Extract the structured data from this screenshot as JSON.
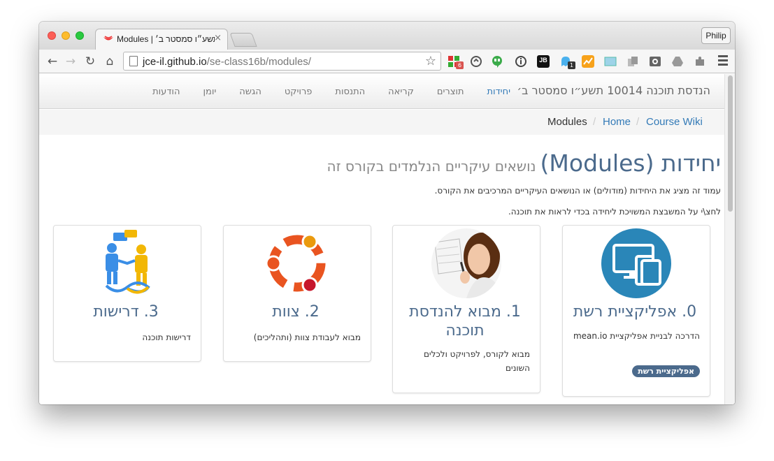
{
  "browser": {
    "tab_title": "Modules | תשע״ו סמסטר ב׳",
    "tab_close": "×",
    "profile": "Philip",
    "url_domain": "jce-il.github.io",
    "url_path": "/se-class16b/modules/",
    "extension_badges": [
      "6",
      "1"
    ],
    "extension_labels": [
      "JB"
    ]
  },
  "navbar": {
    "brand": "הנדסת תוכנה 10014 תשע״ו סמסטר ב׳",
    "links": [
      "יחידות",
      "תוצרים",
      "קריאה",
      "התנסות",
      "פרויקט",
      "הגשה",
      "יומן",
      "הודעות"
    ],
    "active_index": 0
  },
  "breadcrumb": {
    "items": [
      "Course Wiki",
      "Home",
      "Modules"
    ],
    "separator": "/"
  },
  "page": {
    "title_main": "יחידות (Modules)",
    "title_small": "נושאים עיקריים הנלמדים בקורס זה",
    "intro1": "עמוד זה מציג את היחידות (מודולים) או הנושאים העיקריים המרכיבים את הקורס.",
    "intro2": "לחצ\\י על המשבצת המשויכת ליחידה בכדי לראות את תוכנה."
  },
  "cards": [
    {
      "title": "0. אפליקציית רשת",
      "text": "הדרכה לבניית אפליקציית mean.io",
      "badge": "אפליקציית רשת",
      "icon": "devices-icon"
    },
    {
      "title": "1. מבוא להנדסת תוכנה",
      "text": "מבוא לקורס, לפרויקט ולכלים השונים",
      "badge": "",
      "icon": "woman-drawing-photo"
    },
    {
      "title": "2. צוות",
      "text": "מבוא לעבודת צוות (ותהליכים)",
      "badge": "",
      "icon": "ubuntu-logo"
    },
    {
      "title": "3. דרישות",
      "text": "דרישות תוכנה",
      "badge": "",
      "icon": "people-talking-icon"
    }
  ],
  "colors": {
    "accent": "#337ab7",
    "heading": "#4b6a8c",
    "devices_circle": "#2a86b8",
    "ubuntu_orange": "#e95420"
  }
}
